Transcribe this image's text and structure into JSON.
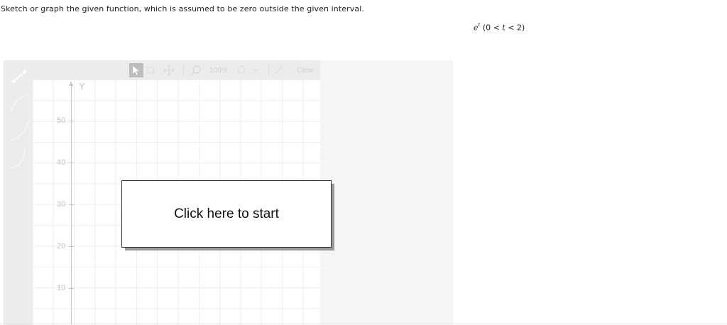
{
  "question": {
    "instruction": "Sketch or graph the given function, which is assumed to be zero outside the given interval.",
    "function_base": "e",
    "function_exponent": "t",
    "interval_prefix": "(0 < ",
    "interval_var": "t",
    "interval_suffix": " < 2)"
  },
  "graph_tool": {
    "toolbar": {
      "zoom_level": "100%",
      "clear_label": "Clear"
    },
    "axis": {
      "y_label": "Y",
      "ticks": [
        "50",
        "40",
        "30",
        "20",
        "10"
      ]
    },
    "palette_icons": [
      "line-tool-icon",
      "curve-up-icon",
      "curve-concave-icon",
      "curve-convex-icon"
    ],
    "start_label": "Click here to start"
  },
  "colors": {
    "panel_bg": "#f4f5f6",
    "toolbar_bg": "#ececec",
    "disabled_text": "#d0d0d0"
  }
}
